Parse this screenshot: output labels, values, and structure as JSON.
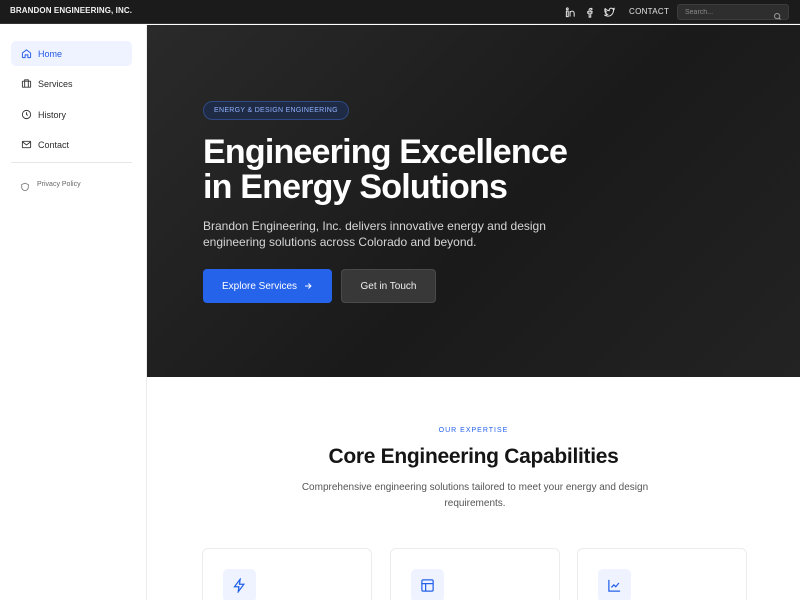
{
  "topbar": {
    "brand": "BRANDON ENGINEERING, INC.",
    "social": [
      {
        "icon": "linkedin-icon"
      },
      {
        "icon": "facebook-icon"
      },
      {
        "icon": "twitter-icon"
      }
    ],
    "contact_link": "CONTACT",
    "search_placeholder": "Search..."
  },
  "sidebar": {
    "items": [
      {
        "label": "Home",
        "icon": "home-icon",
        "active": true
      },
      {
        "label": "Services",
        "icon": "briefcase-icon",
        "active": false
      },
      {
        "label": "History",
        "icon": "clock-icon",
        "active": false
      },
      {
        "label": "Contact",
        "icon": "mail-icon",
        "active": false
      }
    ],
    "privacy_label": "Privacy Policy"
  },
  "hero": {
    "badge": "ENERGY & DESIGN ENGINEERING",
    "title_line1": "Engineering Excellence",
    "title_line2": "in Energy Solutions",
    "subtitle": "Brandon Engineering, Inc. delivers innovative energy and design engineering solutions across Colorado and beyond.",
    "primary_button": "Explore Services",
    "secondary_button": "Get in Touch"
  },
  "expertise": {
    "eyebrow": "OUR EXPERTISE",
    "title": "Core Engineering Capabilities",
    "subtitle": "Comprehensive engineering solutions tailored to meet your energy and design requirements.",
    "cards": [
      {
        "icon": "lightning-icon"
      },
      {
        "icon": "layout-icon"
      },
      {
        "icon": "chart-line-icon"
      }
    ]
  },
  "colors": {
    "accent": "#2563eb",
    "topbar_bg": "#1b1b1b",
    "hero_bg": "#222222",
    "active_nav_bg": "#eef3ff"
  }
}
